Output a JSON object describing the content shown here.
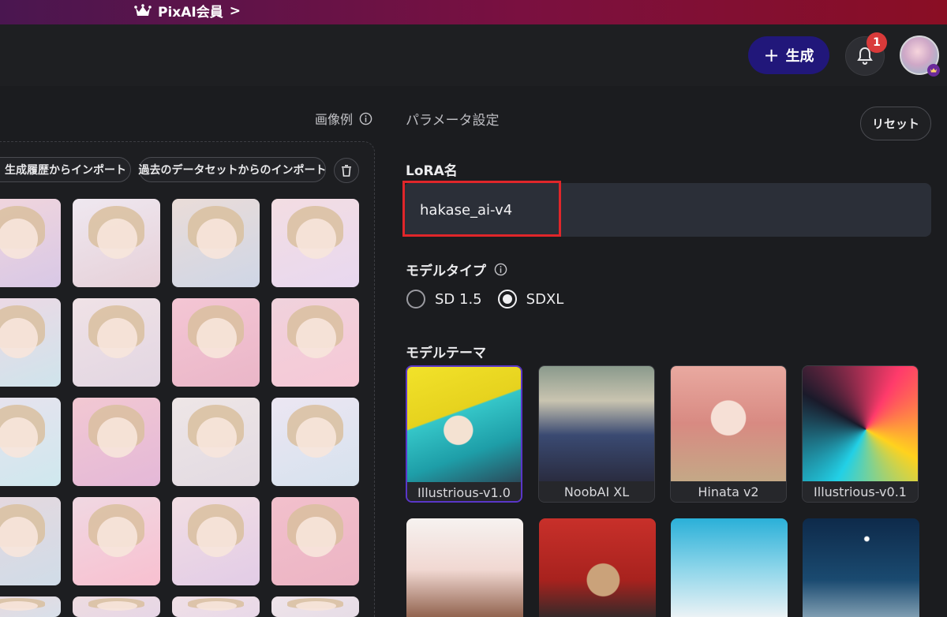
{
  "banner": {
    "label": "PixAI会員",
    "chevron": ">",
    "icon": "crown-icon"
  },
  "header": {
    "generate_label": "生成",
    "generate_plus": "+",
    "notification_count": "1"
  },
  "left": {
    "examples_label": "画像例",
    "import_history_label": "生成履歴からインポート",
    "import_dataset_label": "過去のデータセットからのインポート"
  },
  "right": {
    "title": "パラメータ設定",
    "reset_label": "リセット",
    "lora_label": "LoRA名",
    "lora_value": "hakase_ai-v4",
    "model_type_label": "モデルタイプ",
    "model_types": [
      {
        "label": "SD 1.5",
        "selected": false
      },
      {
        "label": "SDXL",
        "selected": true
      }
    ],
    "model_theme_label": "モデルテーマ",
    "themes": [
      {
        "label": "Illustrious-v1.0",
        "selected": true
      },
      {
        "label": "NoobAI XL",
        "selected": false
      },
      {
        "label": "Hinata v2",
        "selected": false
      },
      {
        "label": "Illustrious-v0.1",
        "selected": false
      }
    ]
  },
  "colors": {
    "accent": "#21177a",
    "highlight": "#e0262a",
    "badge": "#d93a3a",
    "background": "#1b1c1f"
  }
}
